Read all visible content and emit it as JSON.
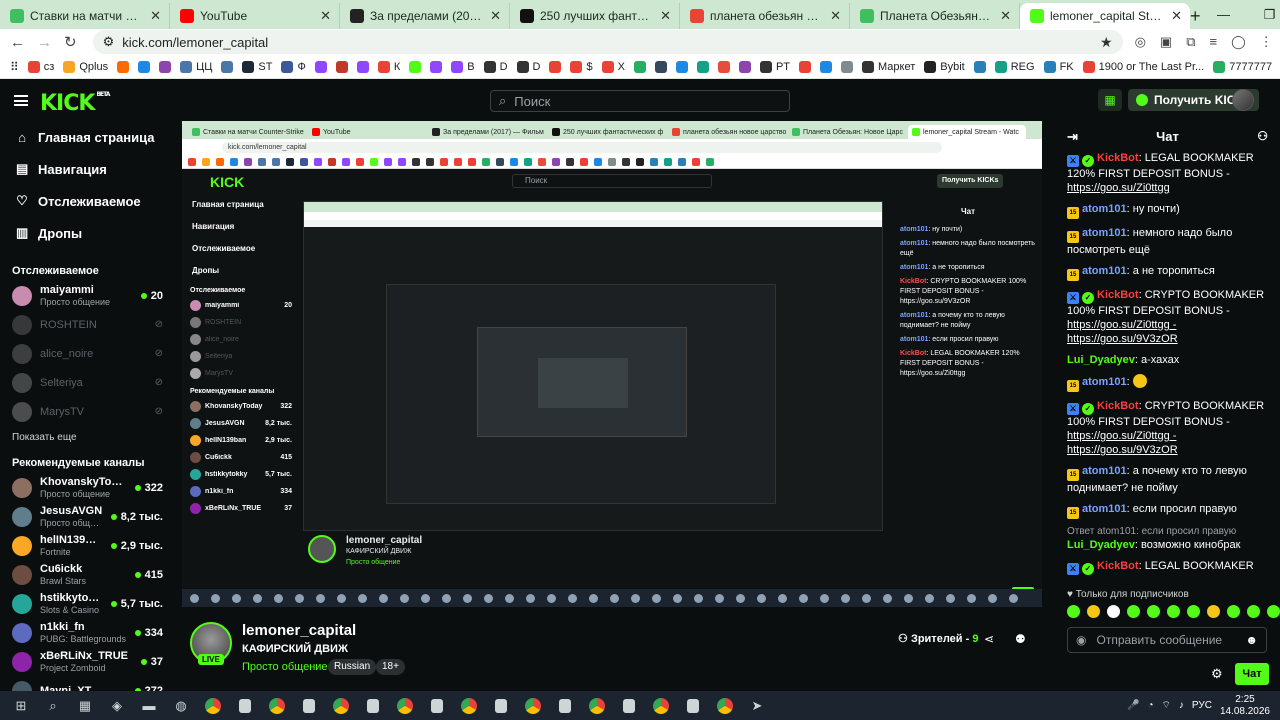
{
  "browser": {
    "tabs": [
      {
        "title": "Ставки на матчи Counter-Strike",
        "color": "#3fbf5f"
      },
      {
        "title": "YouTube",
        "color": "#ff0000"
      },
      {
        "title": "За пределами (2017) — Фильм",
        "color": "#222222"
      },
      {
        "title": "250 лучших фантастических ф",
        "color": "#111111"
      },
      {
        "title": "планета обезьян новое царство",
        "color": "#e94335"
      },
      {
        "title": "Планета Обезьян: Новое Царс",
        "color": "#3fbf5f"
      },
      {
        "title": "lemoner_capital Stream - Watc",
        "color": "#53fc18",
        "active": true
      }
    ],
    "url": "kick.com/lemoner_capital",
    "bookmarks": [
      {
        "label": "сз",
        "color": "#e94335"
      },
      {
        "label": "Qplus",
        "color": "#f5a623"
      },
      {
        "label": "",
        "color": "#ff6a00"
      },
      {
        "label": "",
        "color": "#1e88e5"
      },
      {
        "label": "",
        "color": "#8e44ad"
      },
      {
        "label": "ЦЦ",
        "color": "#4a76a8"
      },
      {
        "label": "",
        "color": "#4a76a8"
      },
      {
        "label": "ST",
        "color": "#1b2838"
      },
      {
        "label": "Ф",
        "color": "#3b5998"
      },
      {
        "label": "",
        "color": "#9146ff"
      },
      {
        "label": "",
        "color": "#c0392b"
      },
      {
        "label": "",
        "color": "#9146ff"
      },
      {
        "label": "К",
        "color": "#e94335"
      },
      {
        "label": "",
        "color": "#53fc18"
      },
      {
        "label": "",
        "color": "#9146ff"
      },
      {
        "label": "B",
        "color": "#9146ff"
      },
      {
        "label": "D",
        "color": "#333333"
      },
      {
        "label": "D",
        "color": "#333333"
      },
      {
        "label": "",
        "color": "#e94335"
      },
      {
        "label": "$",
        "color": "#e94335"
      },
      {
        "label": "X",
        "color": "#e94335"
      },
      {
        "label": "",
        "color": "#27ae60"
      },
      {
        "label": "",
        "color": "#34495e"
      },
      {
        "label": "",
        "color": "#1e88e5"
      },
      {
        "label": "",
        "color": "#16a085"
      },
      {
        "label": "",
        "color": "#e74c3c"
      },
      {
        "label": "",
        "color": "#8e44ad"
      },
      {
        "label": "PT",
        "color": "#333333"
      },
      {
        "label": "",
        "color": "#e94335"
      },
      {
        "label": "",
        "color": "#1e88e5"
      },
      {
        "label": "",
        "color": "#7f8c8d"
      },
      {
        "label": "Маркет",
        "color": "#333333"
      },
      {
        "label": "Bybit",
        "color": "#222222"
      },
      {
        "label": "",
        "color": "#2980b9"
      },
      {
        "label": "REG",
        "color": "#16a085"
      },
      {
        "label": "FK",
        "color": "#2980b9"
      },
      {
        "label": "1900 or The Last Pr...",
        "color": "#e94335"
      },
      {
        "label": "7777777",
        "color": "#27ae60"
      }
    ]
  },
  "kick": {
    "search_placeholder": "Поиск",
    "get_kicks_label": "Получить KICKs",
    "nav": [
      {
        "label": "Главная страница",
        "icon": "home-icon",
        "glyph": "⌂"
      },
      {
        "label": "Навигация",
        "icon": "browse-icon",
        "glyph": "▤"
      },
      {
        "label": "Отслеживаемое",
        "icon": "heart-icon",
        "glyph": "♡"
      },
      {
        "label": "Дропы",
        "icon": "drops-icon",
        "glyph": "▥"
      }
    ],
    "following_title": "Отслеживаемое",
    "following": [
      {
        "name": "maiyammi",
        "category": "Просто общение",
        "viewers": "20",
        "color": "#c98bb0",
        "live": true
      },
      {
        "name": "ROSHTEIN",
        "category": "",
        "viewers": "",
        "color": "#777777",
        "live": false
      },
      {
        "name": "alice_noire",
        "category": "",
        "viewers": "",
        "color": "#888888",
        "live": false
      },
      {
        "name": "Selteriya",
        "category": "",
        "viewers": "",
        "color": "#999999",
        "live": false
      },
      {
        "name": "MarysTV",
        "category": "",
        "viewers": "",
        "color": "#aaaaaa",
        "live": false
      }
    ],
    "show_more": "Показать еще",
    "recommended_title": "Рекомендуемые каналы",
    "recommended": [
      {
        "name": "KhovanskyToday",
        "category": "Просто общение",
        "viewers": "322",
        "color": "#8d6e63"
      },
      {
        "name": "JesusAVGN",
        "category": "Просто общение",
        "viewers": "8,2 тыс.",
        "color": "#607d8b"
      },
      {
        "name": "helIN139ban",
        "category": "Fortnite",
        "viewers": "2,9 тыс.",
        "color": "#f9a825"
      },
      {
        "name": "Cu6ickk",
        "category": "Brawl Stars",
        "viewers": "415",
        "color": "#6d4c41"
      },
      {
        "name": "hstikkytokky",
        "category": "Slots & Casino",
        "viewers": "5,7 тыс.",
        "color": "#26a69a"
      },
      {
        "name": "n1kki_fn",
        "category": "PUBG: Battlegrounds",
        "viewers": "334",
        "color": "#5c6bc0"
      },
      {
        "name": "xBeRLiNx_TRUE",
        "category": "Project Zomboid",
        "viewers": "37",
        "color": "#8e24aa"
      },
      {
        "name": "Mayni_XT",
        "category": "",
        "viewers": "272",
        "color": "#455a64"
      }
    ],
    "chat_title": "Чат",
    "chat_messages": [
      {
        "type": "bot",
        "user": "KickBot",
        "text": "LEGAL BOOKMAKER 120% FIRST DEPOSIT BONUS -",
        "links": [
          "https://goo.su/Zi0ttgg"
        ]
      },
      {
        "type": "atom",
        "user": "atom101",
        "text": "ну почти)"
      },
      {
        "type": "atom",
        "user": "atom101",
        "text": "немного надо было посмотреть ещё"
      },
      {
        "type": "atom",
        "user": "atom101",
        "text": "а не торопиться"
      },
      {
        "type": "bot",
        "user": "KickBot",
        "text": "CRYPTO BOOKMAKER 100% FIRST DEPOSIT BONUS -",
        "links": [
          "https://goo.su/Zi0ttgg -",
          "https://goo.su/9V3zOR"
        ]
      },
      {
        "type": "lui",
        "user": "Lui_Dyadyev",
        "text": "а-хахах"
      },
      {
        "type": "atom",
        "user": "atom101",
        "text": "",
        "emote": true
      },
      {
        "type": "bot",
        "user": "KickBot",
        "text": "CRYPTO BOOKMAKER 100% FIRST DEPOSIT BONUS -",
        "links": [
          "https://goo.su/Zi0ttgg -",
          "https://goo.su/9V3zOR"
        ]
      },
      {
        "type": "atom",
        "user": "atom101",
        "text": "а почему кто то левую поднимает? не пойму"
      },
      {
        "type": "atom",
        "user": "atom101",
        "text": "если просил правую"
      },
      {
        "type": "lui",
        "user": "Lui_Dyadyev",
        "text": "возможно кинобрак",
        "reply": "Ответ atom101: если просил правую"
      },
      {
        "type": "bot",
        "user": "KickBot",
        "text": "LEGAL BOOKMAKER 120% FIRST DEPOSIT BONUS -",
        "links": [
          "https://goo.su/Zi0ttgg"
        ]
      }
    ],
    "subs_only": "Только для подписчиков",
    "send_placeholder": "Отправить сообщение",
    "send_label": "Чат",
    "stream": {
      "channel": "lemoner_capital",
      "title": "КАФИРСКИЙ ДВИЖ",
      "category": "Просто общение",
      "tags": [
        "Russian",
        "18+"
      ],
      "live_label": "LIVE",
      "viewers_label": "Зрителей",
      "viewers_count": "9"
    },
    "captured_frame": {
      "chat_lines": [
        {
          "user": "atom101",
          "text": "ну почти)"
        },
        {
          "user": "atom101",
          "text": "немного надо было посмотреть ещё"
        },
        {
          "user": "atom101",
          "text": "а не торопиться"
        },
        {
          "user": "KickBot",
          "text": "CRYPTO BOOKMAKER 100% FIRST DEPOSIT BONUS - https://goo.su/9V3zOR"
        },
        {
          "user": "atom101",
          "text": "а почему кто то левую поднимает? не пойму"
        },
        {
          "user": "atom101",
          "text": "если просил правую"
        },
        {
          "user": "KickBot",
          "text": "LEGAL BOOKMAKER 120% FIRST DEPOSIT BONUS - https://goo.su/Zi0ttgg"
        }
      ]
    }
  },
  "taskbar": {
    "lang": "РУС",
    "time": "2:25",
    "date": "14.08.2026"
  }
}
